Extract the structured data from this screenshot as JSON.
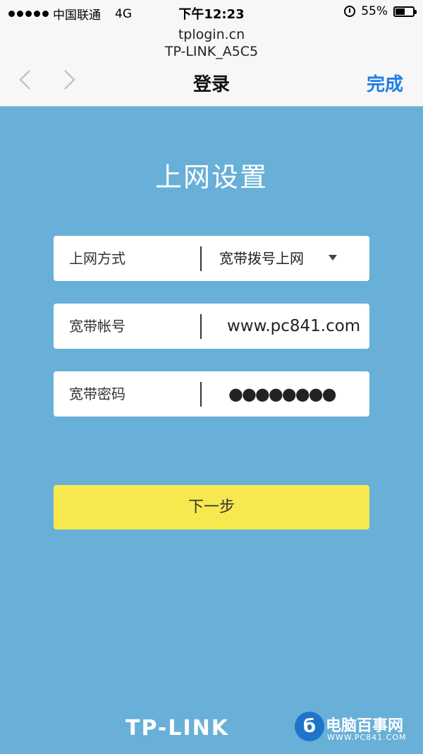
{
  "status_bar": {
    "carrier": "中国联通",
    "network": "4G",
    "time": "下午12:23",
    "battery": "55%",
    "battery_level": 0.55
  },
  "header": {
    "host": "tplogin.cn",
    "ssid": "TP-LINK_A5C5",
    "title": "登录",
    "done_label": "完成"
  },
  "main": {
    "title": "上网设置",
    "fields": [
      {
        "label": "上网方式",
        "value": "宽带拨号上网"
      },
      {
        "label": "宽带帐号",
        "value": "www.pc841.com"
      },
      {
        "label": "宽带密码",
        "value": "●●●●●●●●"
      }
    ],
    "next_label": "下一步"
  },
  "footer": {
    "brand": "TP-LINK",
    "watermark_name": "电脑百事网",
    "watermark_url": "WWW.PC841.COM"
  },
  "colors": {
    "background": "#68b0d8",
    "button": "#f8e84f",
    "link": "#1e7ee8"
  }
}
